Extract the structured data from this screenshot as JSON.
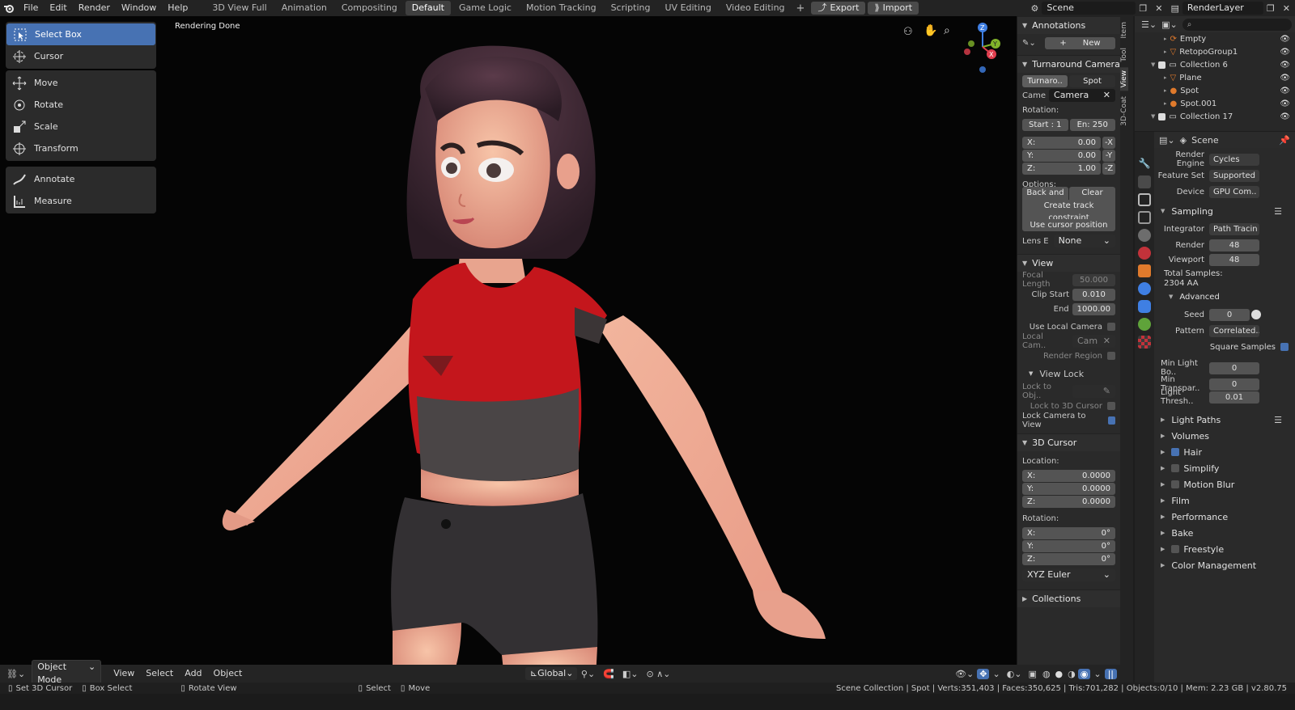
{
  "menu": {
    "file": "File",
    "edit": "Edit",
    "render": "Render",
    "window": "Window",
    "help": "Help"
  },
  "workspaces": [
    "3D View Full",
    "Animation",
    "Compositing",
    "Default",
    "Game Logic",
    "Motion Tracking",
    "Scripting",
    "UV Editing",
    "Video Editing"
  ],
  "active_workspace": "Default",
  "addons": {
    "export": "Export",
    "import": "Import"
  },
  "scene_name": "Scene",
  "render_layer": "RenderLayer",
  "viewport": {
    "status": "Rendering Done"
  },
  "tools": {
    "select_box": "Select Box",
    "cursor": "Cursor",
    "move": "Move",
    "rotate": "Rotate",
    "scale": "Scale",
    "transform": "Transform",
    "annotate": "Annotate",
    "measure": "Measure"
  },
  "npanel": {
    "annotations": "Annotations",
    "new": "New",
    "turnaround": "Turnaround Camera",
    "turnaro_btn": "Turnaro..",
    "spot_btn": "Spot",
    "came_label": "Came",
    "camera": "Camera",
    "rotation": "Rotation:",
    "start": "Start : 1",
    "end": "En: 250",
    "x": "X:",
    "x_val": "0.00",
    "y": "Y:",
    "y_val": "0.00",
    "z": "Z:",
    "z_val": "1.00",
    "neg_x": "-X",
    "neg_y": "-Y",
    "neg_z": "-Z",
    "options": "Options:",
    "back_fo": "Back and fo..",
    "clear_camera": "Clear Camera",
    "track": "Create track constraint",
    "use_cursor": "Use cursor position",
    "lens_e": "Lens E",
    "lens_none": "None",
    "view": "View",
    "focal_length": "Focal Length",
    "focal_val": "50.000",
    "clip_start": "Clip Start",
    "clip_start_val": "0.010",
    "end_lbl": "End",
    "clip_end_val": "1000.00",
    "use_local_camera": "Use Local Camera",
    "local_cam": "Local Cam..",
    "cam": "Cam",
    "render_region": "Render Region",
    "view_lock": "View Lock",
    "lock_to_obj": "Lock to Obj..",
    "lock_3d_cursor": "Lock to 3D Cursor",
    "lock_camera": "Lock Camera to View",
    "cursor3d": "3D Cursor",
    "location": "Location:",
    "loc_x": "0.0000",
    "loc_y": "0.0000",
    "loc_z": "0.0000",
    "rotation2": "Rotation:",
    "rot_x": "0°",
    "rot_y": "0°",
    "rot_z": "0°",
    "euler": "XYZ Euler",
    "collections": "Collections"
  },
  "side_tabs": [
    "Item",
    "Tool",
    "View",
    "3D-Coat"
  ],
  "outliner": [
    {
      "name": "Empty",
      "indent": 2
    },
    {
      "name": "RetopoGroup1",
      "indent": 2
    },
    {
      "name": "Collection 6",
      "indent": 1
    },
    {
      "name": "Plane",
      "indent": 2
    },
    {
      "name": "Spot",
      "indent": 2
    },
    {
      "name": "Spot.001",
      "indent": 2
    },
    {
      "name": "Collection 17",
      "indent": 1
    }
  ],
  "props": {
    "scene": "Scene",
    "render_engine": "Render Engine",
    "render_engine_val": "Cycles",
    "feature_set": "Feature Set",
    "feature_set_val": "Supported",
    "device": "Device",
    "device_val": "GPU Com..",
    "sampling": "Sampling",
    "integrator": "Integrator",
    "integrator_val": "Path Tracin",
    "render": "Render",
    "render_val": "48",
    "viewport": "Viewport",
    "viewport_val": "48",
    "total_samples": "Total Samples:",
    "total_aa": "2304 AA",
    "advanced": "Advanced",
    "seed": "Seed",
    "seed_val": "0",
    "pattern": "Pattern",
    "pattern_val": "Correlated..",
    "square_samples": "Square Samples",
    "min_light": "Min Light Bo..",
    "min_light_val": "0",
    "min_transp": "Min Transpar..",
    "min_transp_val": "0",
    "light_thresh": "Light Thresh..",
    "light_thresh_val": "0.01",
    "sections": [
      "Light Paths",
      "Volumes",
      "Hair",
      "Simplify",
      "Motion Blur",
      "Film",
      "Performance",
      "Bake",
      "Freestyle",
      "Color Management"
    ]
  },
  "header": {
    "object_mode": "Object Mode",
    "view": "View",
    "select": "Select",
    "add": "Add",
    "object": "Object",
    "global": "Global"
  },
  "status": {
    "set_cursor": "Set 3D Cursor",
    "box_select": "Box Select",
    "rotate_view": "Rotate View",
    "select": "Select",
    "move": "Move",
    "stats": "Scene Collection | Spot | Verts:351,403 | Faces:350,625 | Tris:701,282 | Objects:0/10 | Mem: 2.23 GB | v2.80.75"
  }
}
